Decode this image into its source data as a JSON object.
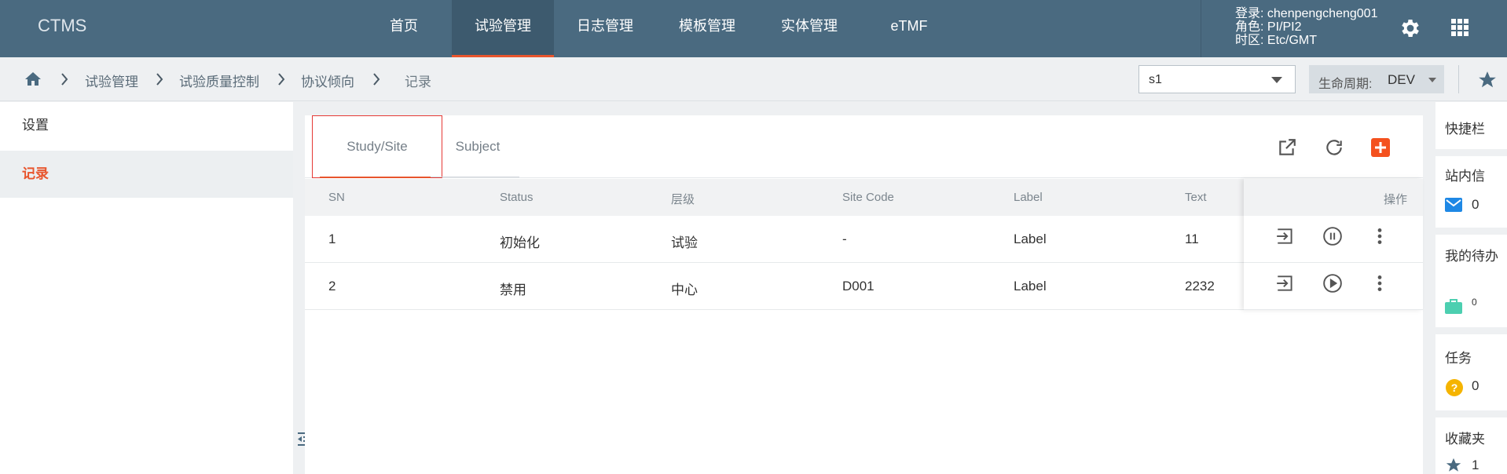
{
  "app": {
    "brand": "CTMS"
  },
  "nav": {
    "items": [
      "首页",
      "试验管理",
      "日志管理",
      "模板管理",
      "实体管理",
      "eTMF"
    ],
    "active_index": 1
  },
  "user": {
    "login": "登录: chenpengcheng001",
    "role": "角色: PI/PI2",
    "timezone": "时区: Etc/GMT"
  },
  "icons": {
    "settings": "gear-icon",
    "apps": "grid-apps-icon",
    "home": "home-icon",
    "favorite": "star-icon"
  },
  "breadcrumb": {
    "items": [
      "试验管理",
      "试验质量控制",
      "协议倾向"
    ],
    "current": "记录"
  },
  "study_select": {
    "value": "s1"
  },
  "lifecycle": {
    "label": "生命周期:",
    "value": "DEV"
  },
  "left_menu": {
    "items": [
      "设置",
      "记录"
    ],
    "active_index": 1
  },
  "tabs": {
    "items": [
      "Study/Site",
      "Subject"
    ],
    "active_index": 0
  },
  "table": {
    "columns": [
      "SN",
      "Status",
      "层级",
      "Site Code",
      "Label",
      "Text",
      "操作"
    ],
    "rows": [
      {
        "sn": "1",
        "status": "初始化",
        "level": "试验",
        "site_code": "-",
        "label": "Label",
        "text": "11",
        "state_action": "pause"
      },
      {
        "sn": "2",
        "status": "禁用",
        "level": "中心",
        "site_code": "D001",
        "label": "Label",
        "text": "2232",
        "state_action": "play"
      }
    ]
  },
  "quickbar": {
    "title": "快捷栏",
    "messages": {
      "label": "站内信",
      "count": "0"
    },
    "todo": {
      "label": "我的待办",
      "count": "0"
    },
    "tasks": {
      "label": "任务",
      "count": "0"
    },
    "favorites": {
      "label": "收藏夹",
      "count": "1"
    }
  },
  "colors": {
    "topbar": "#4a6a80",
    "accent": "#e8552d",
    "add_button": "#f4511e",
    "todo_icon": "#4ccfb0",
    "task_icon": "#f5b400",
    "mail_icon": "#1e88e5"
  }
}
